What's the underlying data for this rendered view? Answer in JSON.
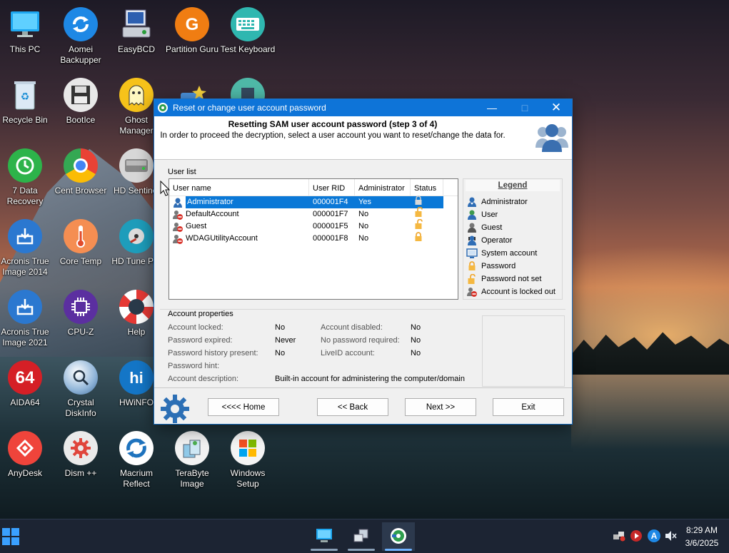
{
  "desktop": {
    "icons": [
      {
        "label": "This PC",
        "icon": "monitor-icon"
      },
      {
        "label": "Aomei Backupper",
        "icon": "sync-icon"
      },
      {
        "label": "EasyBCD",
        "icon": "easybcd-icon"
      },
      {
        "label": "Partition Guru",
        "icon": "partition-guru-icon"
      },
      {
        "label": "Test Keyboard",
        "icon": "keyboard-icon"
      },
      {
        "label": "Recycle Bin",
        "icon": "recycle-bin-icon"
      },
      {
        "label": "BootIce",
        "icon": "floppy-icon"
      },
      {
        "label": "Ghost Manager",
        "icon": "ghost-icon"
      },
      {
        "label": "7 Data Recovery",
        "icon": "recovery-icon"
      },
      {
        "label": "Cent Browser",
        "icon": "browser-icon"
      },
      {
        "label": "HD Sentinel",
        "icon": "hdd-icon"
      },
      {
        "label": "Acronis True Image 2014",
        "icon": "acronis-icon"
      },
      {
        "label": "Core Temp",
        "icon": "thermometer-icon"
      },
      {
        "label": "HD Tune Pro",
        "icon": "hdtune-icon"
      },
      {
        "label": "Acronis True Image 2021",
        "icon": "acronis-icon"
      },
      {
        "label": "CPU-Z",
        "icon": "cpu-icon"
      },
      {
        "label": "Help",
        "icon": "lifebuoy-icon"
      },
      {
        "label": "AIDA64",
        "icon": "aida64-icon"
      },
      {
        "label": "Crystal DiskInfo",
        "icon": "crystaldisk-icon"
      },
      {
        "label": "HWiNFO",
        "icon": "hwinfo-icon"
      },
      {
        "label": "AnyDesk",
        "icon": "anydesk-icon"
      },
      {
        "label": "Dism ++",
        "icon": "gear-icon"
      },
      {
        "label": "Macrium Reflect",
        "icon": "macrium-icon"
      },
      {
        "label": "TeraByte Image",
        "icon": "terabyte-icon"
      },
      {
        "label": "Windows Setup",
        "icon": "windows-logo-icon"
      }
    ],
    "icon_glyphs": {
      "aida64": "64",
      "hwinfo": "hi"
    }
  },
  "dialog": {
    "title": "Reset or change user account password",
    "header_title": "Resetting SAM user account password (step 3 of 4)",
    "header_subtitle": "In order to proceed the decryption, select a user account you want to reset/change the data for.",
    "user_list_label": "User list",
    "columns": [
      "User name",
      "User RID",
      "Administrator",
      "Status"
    ],
    "users": [
      {
        "name": "Administrator",
        "rid": "000001F4",
        "admin": "Yes",
        "status": "password",
        "selected": true,
        "type": "administrator"
      },
      {
        "name": "DefaultAccount",
        "rid": "000001F7",
        "admin": "No",
        "status": "password-not-set",
        "selected": false,
        "type": "locked-out"
      },
      {
        "name": "Guest",
        "rid": "000001F5",
        "admin": "No",
        "status": "password-not-set",
        "selected": false,
        "type": "locked-out"
      },
      {
        "name": "WDAGUtilityAccount",
        "rid": "000001F8",
        "admin": "No",
        "status": "password",
        "selected": false,
        "type": "locked-out"
      }
    ],
    "legend": {
      "title": "Legend",
      "items": [
        {
          "label": "Administrator",
          "icon": "administrator-icon"
        },
        {
          "label": "User",
          "icon": "user-icon"
        },
        {
          "label": "Guest",
          "icon": "guest-icon"
        },
        {
          "label": "Operator",
          "icon": "operator-icon"
        },
        {
          "label": "System account",
          "icon": "system-account-icon"
        },
        {
          "label": "Password",
          "icon": "password-lock-icon"
        },
        {
          "label": "Password not set",
          "icon": "password-not-set-icon"
        },
        {
          "label": "Account is locked out",
          "icon": "locked-out-icon"
        }
      ]
    },
    "account_properties": {
      "label": "Account properties",
      "account_locked_label": "Account locked:",
      "account_locked": "No",
      "password_expired_label": "Password expired:",
      "password_expired": "Never",
      "password_history_label": "Password history present:",
      "password_history": "No",
      "password_hint_label": "Password hint:",
      "password_hint": "",
      "account_description_label": "Account description:",
      "account_description": "Built-in account for administering the computer/domain",
      "account_disabled_label": "Account disabled:",
      "account_disabled": "No",
      "no_password_required_label": "No password required:",
      "no_password_required": "No",
      "liveid_account_label": "LiveID account:",
      "liveid_account": "No"
    },
    "buttons": {
      "home": "<<<< Home",
      "back": "<< Back",
      "next": "Next >>",
      "exit": "Exit"
    }
  },
  "taskbar": {
    "time": "8:29 AM",
    "date": "3/6/2025",
    "tray_letter": "A"
  },
  "colors": {
    "titlebar": "#0e74d8",
    "selection": "#0a78d7",
    "taskbar": "#1c2433"
  }
}
